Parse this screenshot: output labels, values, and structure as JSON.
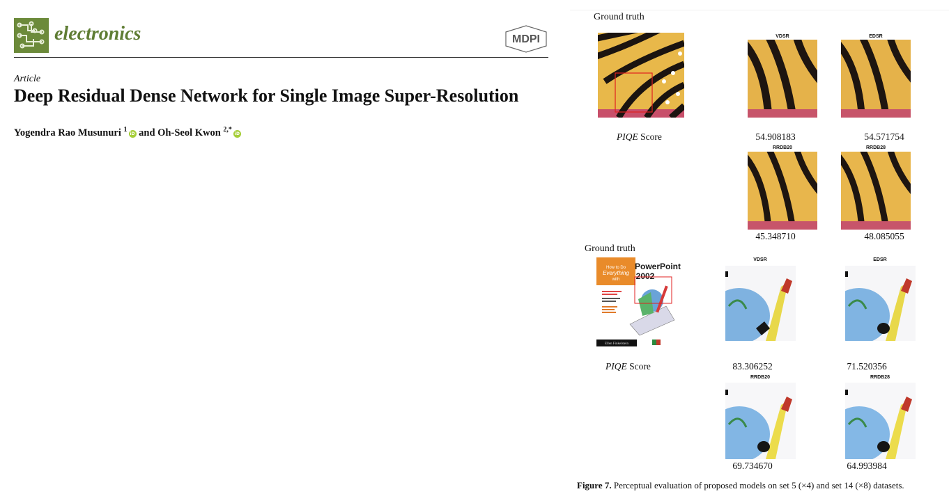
{
  "journal": {
    "name": "electronics",
    "publisher_logo": "MDPI"
  },
  "article": {
    "type": "Article",
    "title": "Deep Residual Dense Network for Single Image Super-Resolution",
    "author1": "Yogendra Rao Musunuri",
    "author1_sup": "1",
    "author_join": "and",
    "author2": "Oh-Seol Kwon",
    "author2_sup": "2,*"
  },
  "figure": {
    "panels": [
      {
        "ground_truth_label": "Ground truth",
        "score_label_italic": "PIQE",
        "score_label_rest": "Score",
        "methods": [
          {
            "name": "VDSR",
            "score": "54.908183"
          },
          {
            "name": "EDSR",
            "score": "54.571754"
          },
          {
            "name": "RRDB20",
            "score": "45.348710"
          },
          {
            "name": "RRDB28",
            "score": "48.085055"
          }
        ]
      },
      {
        "ground_truth_label": "Ground truth",
        "score_label_italic": "PIQE",
        "score_label_rest": "Score",
        "cover_text": {
          "how_to": "How to Do",
          "everything": "Everything",
          "with": "with",
          "product": "PowerPoint",
          "year": "2002",
          "author": "Ellen Finkelstein"
        },
        "methods": [
          {
            "name": "VDSR",
            "score": "83.306252"
          },
          {
            "name": "EDSR",
            "score": "71.520356"
          },
          {
            "name": "RRDB20",
            "score": "69.734670"
          },
          {
            "name": "RRDB28",
            "score": "64.993984"
          }
        ]
      }
    ],
    "caption_label": "Figure 7.",
    "caption_text": "Perceptual evaluation of proposed models on set 5 (×4) and set 14 (×8) datasets."
  },
  "colors": {
    "journal_green": "#6c8a3a",
    "orcid_green": "#a6ce39",
    "highlight_red": "#e02020",
    "butterfly_yellow": "#e8b84a",
    "butterfly_black": "#1b1410"
  },
  "icons": [
    "journal-logo-icon",
    "mdpi-logo-icon",
    "orcid-icon"
  ]
}
